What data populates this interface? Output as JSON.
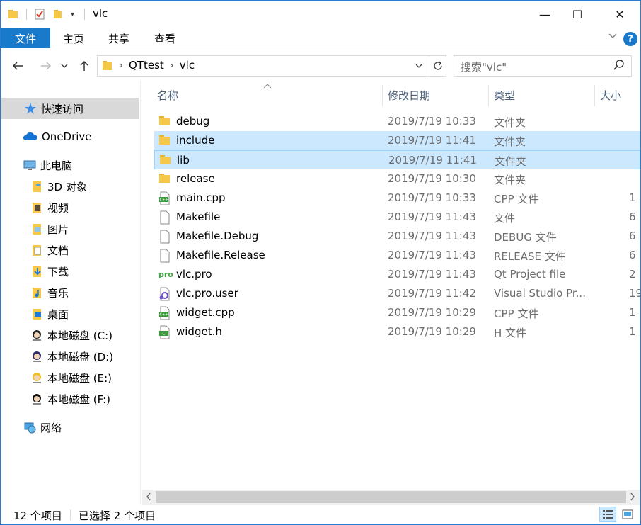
{
  "window": {
    "title": "vlc",
    "controls": {
      "minimize": "—",
      "maximize": "☐",
      "close": "✕"
    }
  },
  "ribbon": {
    "tabs": [
      {
        "label": "文件"
      },
      {
        "label": "主页"
      },
      {
        "label": "共享"
      },
      {
        "label": "查看"
      }
    ]
  },
  "address": {
    "crumbs": [
      "QTtest",
      "vlc"
    ],
    "separator": "›"
  },
  "search": {
    "placeholder": "搜索\"vlc\""
  },
  "nav": {
    "items": [
      {
        "label": "快速访问",
        "icon": "star-icon"
      },
      {
        "label": "OneDrive",
        "icon": "cloud-icon"
      },
      {
        "label": "此电脑",
        "icon": "computer-icon"
      },
      {
        "label": "3D 对象",
        "icon": "3d-objects-icon"
      },
      {
        "label": "视频",
        "icon": "video-icon"
      },
      {
        "label": "图片",
        "icon": "pictures-icon"
      },
      {
        "label": "文档",
        "icon": "documents-icon"
      },
      {
        "label": "下载",
        "icon": "download-icon"
      },
      {
        "label": "音乐",
        "icon": "music-icon"
      },
      {
        "label": "桌面",
        "icon": "desktop-icon"
      },
      {
        "label": "本地磁盘 (C:)",
        "icon": "drive-icon"
      },
      {
        "label": "本地磁盘 (D:)",
        "icon": "drive-icon"
      },
      {
        "label": "本地磁盘 (E:)",
        "icon": "drive-icon"
      },
      {
        "label": "本地磁盘 (F:)",
        "icon": "drive-icon"
      },
      {
        "label": "网络",
        "icon": "network-icon"
      }
    ]
  },
  "columns": {
    "name": "名称",
    "date": "修改日期",
    "type": "类型",
    "size": "大小"
  },
  "files": [
    {
      "name": "debug",
      "date": "2019/7/19 10:33",
      "type": "文件夹",
      "size": "",
      "icon": "folder-icon"
    },
    {
      "name": "include",
      "date": "2019/7/19 11:41",
      "type": "文件夹",
      "size": "",
      "icon": "folder-icon"
    },
    {
      "name": "lib",
      "date": "2019/7/19 11:41",
      "type": "文件夹",
      "size": "",
      "icon": "folder-icon"
    },
    {
      "name": "release",
      "date": "2019/7/19 10:30",
      "type": "文件夹",
      "size": "",
      "icon": "folder-icon"
    },
    {
      "name": "main.cpp",
      "date": "2019/7/19 10:33",
      "type": "CPP 文件",
      "size": "1",
      "icon": "cpp-file-icon"
    },
    {
      "name": "Makefile",
      "date": "2019/7/19 11:43",
      "type": "文件",
      "size": "6",
      "icon": "file-icon"
    },
    {
      "name": "Makefile.Debug",
      "date": "2019/7/19 11:43",
      "type": "DEBUG 文件",
      "size": "6",
      "icon": "file-icon"
    },
    {
      "name": "Makefile.Release",
      "date": "2019/7/19 11:43",
      "type": "RELEASE 文件",
      "size": "6",
      "icon": "file-icon"
    },
    {
      "name": "vlc.pro",
      "date": "2019/7/19 11:43",
      "type": "Qt Project file",
      "size": "2",
      "icon": "qt-pro-icon"
    },
    {
      "name": "vlc.pro.user",
      "date": "2019/7/19 11:42",
      "type": "Visual Studio Pr...",
      "size": "19",
      "icon": "vs-project-icon"
    },
    {
      "name": "widget.cpp",
      "date": "2019/7/19 10:29",
      "type": "CPP 文件",
      "size": "1",
      "icon": "cpp-file-icon"
    },
    {
      "name": "widget.h",
      "date": "2019/7/19 10:29",
      "type": "H 文件",
      "size": "1",
      "icon": "h-file-icon"
    }
  ],
  "status": {
    "count": "12 个项目",
    "selected": "已选择 2 个项目"
  }
}
